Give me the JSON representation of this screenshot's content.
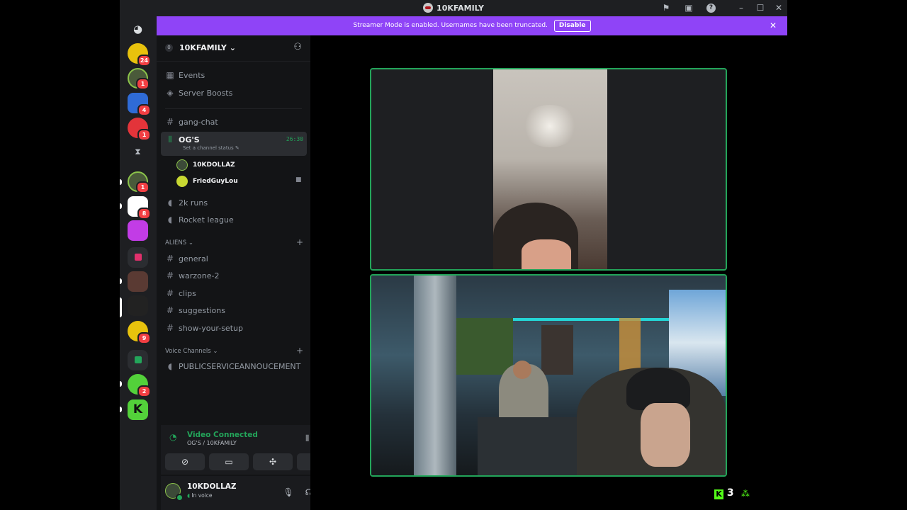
{
  "window": {
    "title": "10KFAMILY"
  },
  "banner": {
    "text": "Streamer Mode is enabled. Usernames have been truncated.",
    "disable_label": "Disable"
  },
  "rail": {
    "badges": [
      "24",
      "1",
      "4",
      "1",
      "1",
      "8",
      "9",
      "2"
    ]
  },
  "guild": {
    "name": "10KFAMILY",
    "boost_level": "0"
  },
  "top_items": [
    {
      "label": "Events",
      "icon": "calendar-icon"
    },
    {
      "label": "Server Boosts",
      "icon": "boost-icon"
    }
  ],
  "channels": {
    "gang_chat": "gang-chat",
    "ogs": {
      "name": "OG'S",
      "status": "Set a channel status",
      "timer": "26:30"
    },
    "members": [
      "10KDOLLAZ",
      "FriedGuyLou"
    ],
    "two_k": "2k runs",
    "rocket": "Rocket league",
    "aliens_category": "ALIENS",
    "aliens": [
      "general",
      "warzone-2",
      "clips",
      "suggestions",
      "show-your-setup"
    ],
    "voice_category": "Voice Channels",
    "psa": "PUBLICSERVICEANNOUCEMENT"
  },
  "voice": {
    "status": "Video Connected",
    "location": "OG'S / 10KFAMILY"
  },
  "user": {
    "name": "10KDOLLAZ",
    "status": "In voice"
  },
  "overlay": {
    "count": "3"
  },
  "colors": {
    "accent_green": "#23a55a",
    "banner_purple": "#8f44f7",
    "badge_red": "#f23f43"
  }
}
